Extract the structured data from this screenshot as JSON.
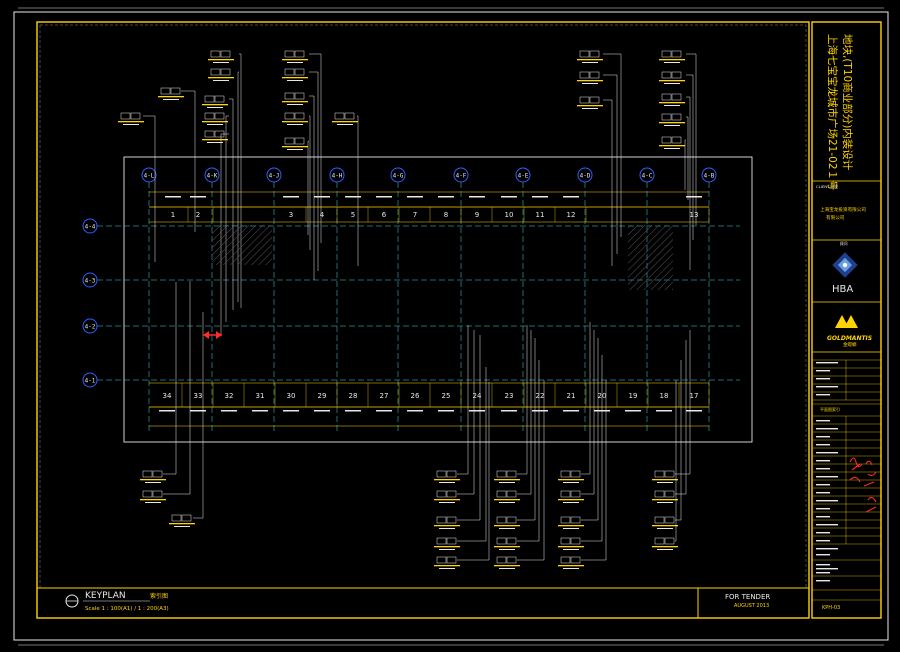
{
  "drawing": {
    "title_cn_line1": "上海七宝宝龙城市广场21-02１号",
    "title_cn_line2": "地块,(T10商业部分)内装设计",
    "client_label": "CLIENT 业主",
    "client_name_line1": "上海宝龙投资有限公司",
    "client_name_line2": "有限公司",
    "consultant_label": "顾问",
    "firm_logo": "HBA",
    "firm_logo2": "GOLDMANTIS",
    "firm_cn": "金螳螂",
    "keyplan_title": "KEYPLAN",
    "keyplan_cn": "索引图",
    "scale": "Scale 1 : 100(A1) / 1 : 200(A3)",
    "stage": "FOR TENDER",
    "date": "AUGUST 2013",
    "sheet_no": "KPH-03",
    "drawing_title_label": "平面图索引"
  },
  "grid": {
    "columns": [
      "4-L",
      "4-K",
      "4-J",
      "4-H",
      "4-G",
      "4-F",
      "4-E",
      "4-D",
      "4-C",
      "4-B"
    ],
    "rows": [
      "4-4",
      "4-3",
      "4-2",
      "4-1"
    ]
  },
  "units": {
    "top": [
      "1",
      "2",
      "3",
      "4",
      "5",
      "6",
      "7",
      "8",
      "9",
      "10",
      "11",
      "12",
      "13"
    ],
    "bottom": [
      "34",
      "33",
      "32",
      "31",
      "30",
      "29",
      "28",
      "27",
      "26",
      "25",
      "24",
      "23",
      "22",
      "21",
      "20",
      "19",
      "18",
      "17"
    ]
  },
  "colors": {
    "frame": "#ffd400",
    "grid": "#3fd8e0",
    "text": "#e8e8e8",
    "accent": "#ff2b2b"
  }
}
